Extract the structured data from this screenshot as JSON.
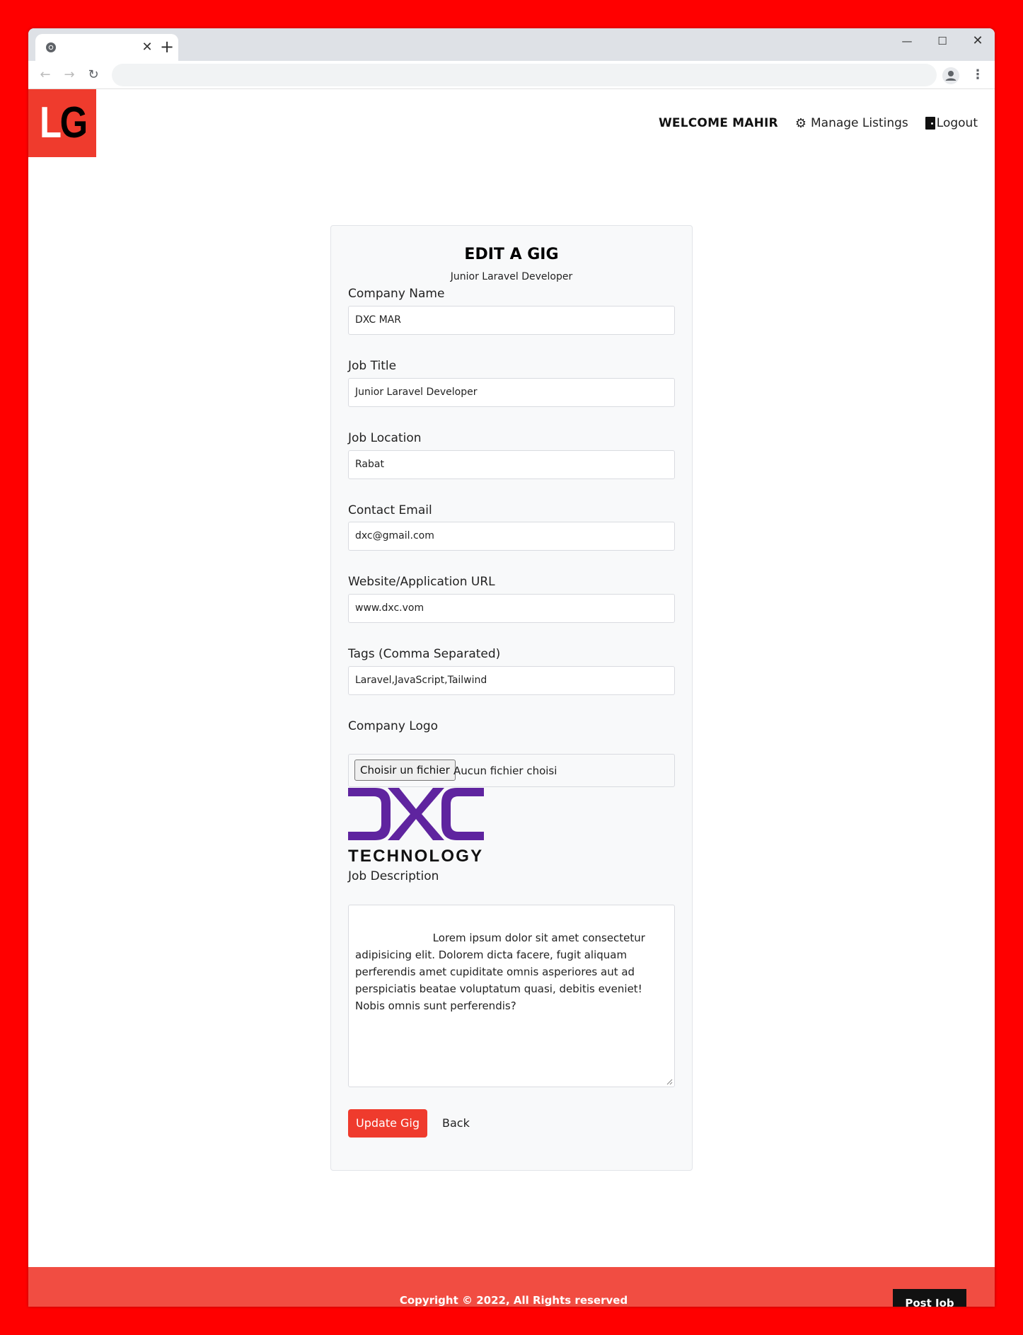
{
  "browser": {
    "tab_close": "✕",
    "new_tab": "+",
    "minimize": "—",
    "maximize": "☐",
    "close": "✕"
  },
  "logo": {
    "letter1": "L",
    "letter2": "G"
  },
  "nav": {
    "welcome": "WELCOME MAHIR",
    "manage_listings": "Manage Listings",
    "logout": "Logout"
  },
  "form": {
    "title": "EDIT A GIG",
    "subtitle": "Junior Laravel Developer",
    "fields": [
      {
        "label": "Company Name",
        "value": "DXC MAR"
      },
      {
        "label": "Job Title",
        "value": "Junior Laravel Developer"
      },
      {
        "label": "Job Location",
        "value": "Rabat"
      },
      {
        "label": "Contact Email",
        "value": "dxc@gmail.com"
      },
      {
        "label": "Website/Application URL",
        "value": "www.dxc.vom"
      },
      {
        "label": "Tags (Comma Separated)",
        "value": "Laravel,JavaScript,Tailwind"
      }
    ],
    "logo_label": "Company Logo",
    "file_button": "Choisir un fichier",
    "file_status": "Aucun fichier choisi",
    "company_logo_text": "TECHNOLOGY",
    "description_label": "Job Description",
    "description": "               Lorem ipsum dolor sit amet consectetur adipisicing elit. Dolorem dicta facere, fugit aliquam perferendis amet cupiditate omnis asperiores aut ad perspiciatis beatae voluptatum quasi, debitis eveniet! Nobis omnis sunt perferendis?",
    "submit": "Update Gig",
    "back": "Back"
  },
  "footer": {
    "copyright": "Copyright © 2022, All Rights reserved",
    "post_job": "Post Job"
  },
  "colors": {
    "brand": "#ef3b2d",
    "footer": "#f14d42",
    "dxc_purple": "#5f249f"
  },
  "icons": [
    "chrome-icon",
    "back-arrow-icon",
    "forward-arrow-icon",
    "reload-icon",
    "star-icon",
    "profile-icon",
    "menu-dots-icon",
    "gear-icon",
    "door-icon"
  ]
}
